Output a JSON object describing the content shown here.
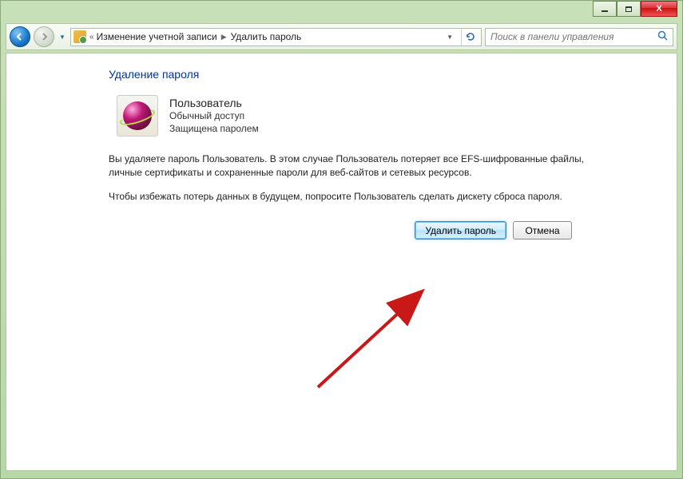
{
  "window": {
    "minimize_label": "–",
    "maximize_label": "□",
    "close_label": "X"
  },
  "breadcrumb": {
    "root_icon": "user-accounts-icon",
    "item1": "Изменение учетной записи",
    "item2": "Удалить пароль"
  },
  "search": {
    "placeholder": "Поиск в панели управления"
  },
  "page": {
    "title": "Удаление пароля",
    "user": {
      "name": "Пользователь",
      "access": "Обычный доступ",
      "protection": "Защищена паролем"
    },
    "paragraph1": "Вы удаляете пароль Пользователь. В этом случае Пользователь потеряет все EFS-шифрованные файлы, личные сертификаты и сохраненные пароли для веб-сайтов и сетевых ресурсов.",
    "paragraph2": "Чтобы избежать потерь данных в будущем, попросите Пользователь сделать дискету сброса пароля."
  },
  "buttons": {
    "delete": "Удалить пароль",
    "cancel": "Отмена"
  },
  "annotation": {
    "arrow_color": "#c81818"
  }
}
